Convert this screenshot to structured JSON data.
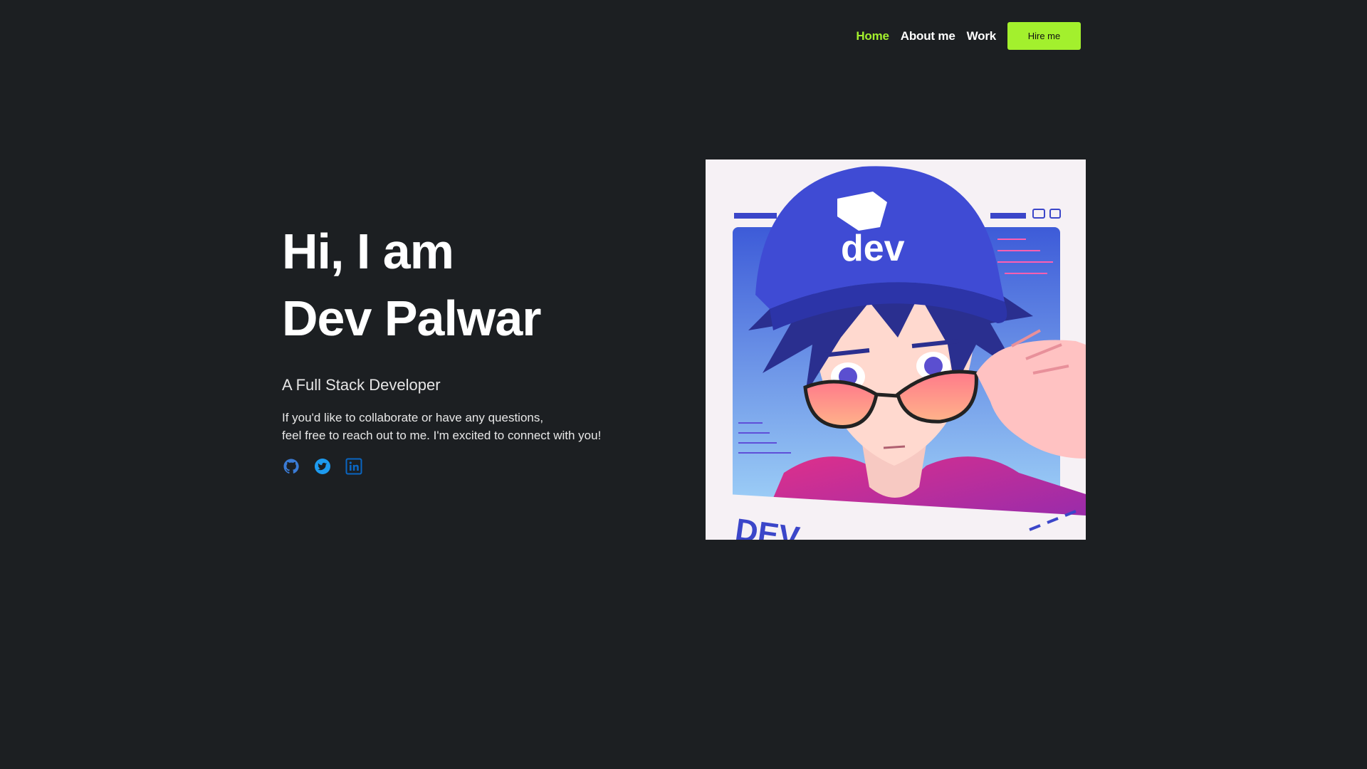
{
  "nav": {
    "items": [
      {
        "label": "Home",
        "active": true
      },
      {
        "label": "About me",
        "active": false
      },
      {
        "label": "Work",
        "active": false
      }
    ],
    "hire_label": "Hire me"
  },
  "hero": {
    "greeting": "Hi, I am",
    "name": "Dev Palwar",
    "subtitle": "A Full Stack Developer",
    "blurb_line1": "If you'd like to collaborate or have any questions,",
    "blurb_line2": "feel free to reach out to me. I'm excited to connect with you!"
  },
  "portrait": {
    "cap_text": "dev"
  },
  "socials": [
    {
      "icon": "github-icon"
    },
    {
      "icon": "twitter-icon"
    },
    {
      "icon": "linkedin-icon"
    }
  ],
  "colors": {
    "background": "#1c1f22",
    "accent": "#a3f02d",
    "social_blue": "#2f7fd1"
  }
}
